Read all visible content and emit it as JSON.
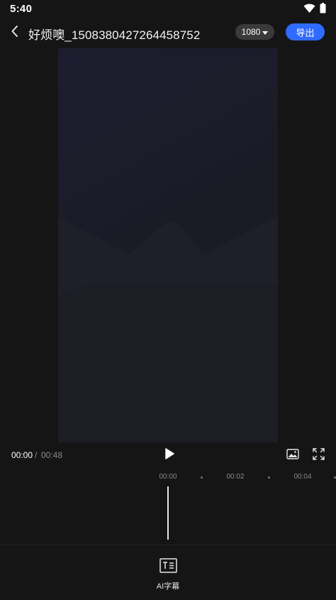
{
  "status_bar": {
    "time": "5:40",
    "icons": [
      "wifi-icon",
      "battery-icon"
    ]
  },
  "header": {
    "back_icon": "chevron-left-icon",
    "title": "好烦噢_1508380427264458752",
    "resolution_label": "1080",
    "export_label": "导出"
  },
  "player": {
    "current_time": "00:00",
    "separator": "/",
    "total_time": "00:48",
    "play_icon": "play-icon",
    "image_icon": "image-icon",
    "fullscreen_icon": "fullscreen-icon"
  },
  "timeline": {
    "ticks": [
      "00:00",
      "00:02",
      "00:04"
    ]
  },
  "toolbar": {
    "ai_subtitle_label": "AI字幕",
    "ai_subtitle_icon": "text-subtitle-icon"
  },
  "colors": {
    "background": "#151515",
    "accent": "#2f6bff",
    "preview_top": "#1c1c2e"
  }
}
